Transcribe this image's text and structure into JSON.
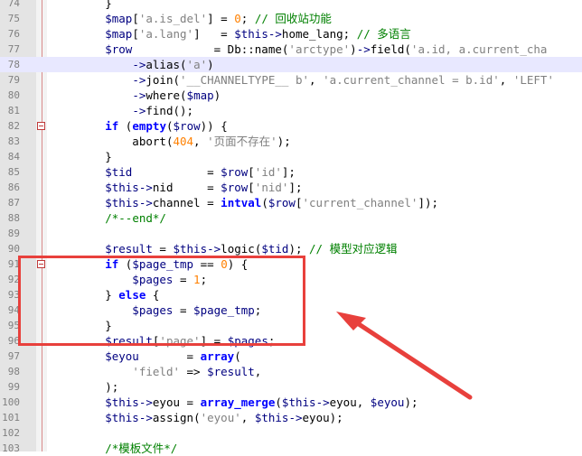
{
  "editor": {
    "lines": [
      {
        "n": "74",
        "fold": false,
        "current": false,
        "tokens": [
          {
            "t": "        }",
            "c": "plain"
          }
        ]
      },
      {
        "n": "75",
        "fold": false,
        "current": false,
        "tokens": [
          {
            "t": "        $map",
            "c": "var"
          },
          {
            "t": "[",
            "c": "plain"
          },
          {
            "t": "'a.is_del'",
            "c": "str"
          },
          {
            "t": "] = ",
            "c": "plain"
          },
          {
            "t": "0",
            "c": "num"
          },
          {
            "t": "; ",
            "c": "plain"
          },
          {
            "t": "// 回收站功能",
            "c": "com"
          }
        ]
      },
      {
        "n": "76",
        "fold": false,
        "current": false,
        "tokens": [
          {
            "t": "        $map",
            "c": "var"
          },
          {
            "t": "[",
            "c": "plain"
          },
          {
            "t": "'a.lang'",
            "c": "str"
          },
          {
            "t": "]   = ",
            "c": "plain"
          },
          {
            "t": "$this",
            "c": "var"
          },
          {
            "t": "->",
            "c": "op"
          },
          {
            "t": "home_lang",
            "c": "fn"
          },
          {
            "t": "; ",
            "c": "plain"
          },
          {
            "t": "// 多语言",
            "c": "com"
          }
        ]
      },
      {
        "n": "77",
        "fold": false,
        "current": false,
        "tokens": [
          {
            "t": "        $row",
            "c": "var"
          },
          {
            "t": "            = ",
            "c": "plain"
          },
          {
            "t": "Db::name",
            "c": "fn"
          },
          {
            "t": "(",
            "c": "plain"
          },
          {
            "t": "'arctype'",
            "c": "str"
          },
          {
            "t": ")",
            "c": "plain"
          },
          {
            "t": "->",
            "c": "op"
          },
          {
            "t": "field",
            "c": "fn"
          },
          {
            "t": "(",
            "c": "plain"
          },
          {
            "t": "'a.id, a.current_cha",
            "c": "str"
          }
        ]
      },
      {
        "n": "78",
        "fold": false,
        "current": true,
        "tokens": [
          {
            "t": "            ",
            "c": "plain"
          },
          {
            "t": "->",
            "c": "op"
          },
          {
            "t": "alias",
            "c": "fn"
          },
          {
            "t": "(",
            "c": "plain"
          },
          {
            "t": "'a'",
            "c": "str"
          },
          {
            "t": ")",
            "c": "plain"
          }
        ]
      },
      {
        "n": "79",
        "fold": false,
        "current": false,
        "tokens": [
          {
            "t": "            ",
            "c": "plain"
          },
          {
            "t": "->",
            "c": "op"
          },
          {
            "t": "join",
            "c": "fn"
          },
          {
            "t": "(",
            "c": "plain"
          },
          {
            "t": "'__CHANNELTYPE__ b'",
            "c": "str"
          },
          {
            "t": ", ",
            "c": "plain"
          },
          {
            "t": "'a.current_channel = b.id'",
            "c": "str"
          },
          {
            "t": ", ",
            "c": "plain"
          },
          {
            "t": "'LEFT'",
            "c": "str"
          }
        ]
      },
      {
        "n": "80",
        "fold": false,
        "current": false,
        "tokens": [
          {
            "t": "            ",
            "c": "plain"
          },
          {
            "t": "->",
            "c": "op"
          },
          {
            "t": "where",
            "c": "fn"
          },
          {
            "t": "(",
            "c": "plain"
          },
          {
            "t": "$map",
            "c": "var"
          },
          {
            "t": ")",
            "c": "plain"
          }
        ]
      },
      {
        "n": "81",
        "fold": false,
        "current": false,
        "tokens": [
          {
            "t": "            ",
            "c": "plain"
          },
          {
            "t": "->",
            "c": "op"
          },
          {
            "t": "find",
            "c": "fn"
          },
          {
            "t": "();",
            "c": "plain"
          }
        ]
      },
      {
        "n": "82",
        "fold": true,
        "current": false,
        "tokens": [
          {
            "t": "        ",
            "c": "plain"
          },
          {
            "t": "if",
            "c": "kw"
          },
          {
            "t": " (",
            "c": "plain"
          },
          {
            "t": "empty",
            "c": "kw"
          },
          {
            "t": "(",
            "c": "plain"
          },
          {
            "t": "$row",
            "c": "var"
          },
          {
            "t": ")) {",
            "c": "plain"
          }
        ]
      },
      {
        "n": "83",
        "fold": false,
        "current": false,
        "tokens": [
          {
            "t": "            abort",
            "c": "fn"
          },
          {
            "t": "(",
            "c": "plain"
          },
          {
            "t": "404",
            "c": "num"
          },
          {
            "t": ", ",
            "c": "plain"
          },
          {
            "t": "'页面不存在'",
            "c": "str"
          },
          {
            "t": ");",
            "c": "plain"
          }
        ]
      },
      {
        "n": "84",
        "fold": false,
        "current": false,
        "tokens": [
          {
            "t": "        }",
            "c": "plain"
          }
        ]
      },
      {
        "n": "85",
        "fold": false,
        "current": false,
        "tokens": [
          {
            "t": "        $tid",
            "c": "var"
          },
          {
            "t": "           = ",
            "c": "plain"
          },
          {
            "t": "$row",
            "c": "var"
          },
          {
            "t": "[",
            "c": "plain"
          },
          {
            "t": "'id'",
            "c": "str"
          },
          {
            "t": "];",
            "c": "plain"
          }
        ]
      },
      {
        "n": "86",
        "fold": false,
        "current": false,
        "tokens": [
          {
            "t": "        $this",
            "c": "var"
          },
          {
            "t": "->",
            "c": "op"
          },
          {
            "t": "nid",
            "c": "fn"
          },
          {
            "t": "     = ",
            "c": "plain"
          },
          {
            "t": "$row",
            "c": "var"
          },
          {
            "t": "[",
            "c": "plain"
          },
          {
            "t": "'nid'",
            "c": "str"
          },
          {
            "t": "];",
            "c": "plain"
          }
        ]
      },
      {
        "n": "87",
        "fold": false,
        "current": false,
        "tokens": [
          {
            "t": "        $this",
            "c": "var"
          },
          {
            "t": "->",
            "c": "op"
          },
          {
            "t": "channel",
            "c": "fn"
          },
          {
            "t": " = ",
            "c": "plain"
          },
          {
            "t": "intval",
            "c": "kw"
          },
          {
            "t": "(",
            "c": "plain"
          },
          {
            "t": "$row",
            "c": "var"
          },
          {
            "t": "[",
            "c": "plain"
          },
          {
            "t": "'current_channel'",
            "c": "str"
          },
          {
            "t": "]);",
            "c": "plain"
          }
        ]
      },
      {
        "n": "88",
        "fold": false,
        "current": false,
        "tokens": [
          {
            "t": "        ",
            "c": "plain"
          },
          {
            "t": "/*--end*/",
            "c": "com"
          }
        ]
      },
      {
        "n": "89",
        "fold": false,
        "current": false,
        "tokens": [
          {
            "t": "",
            "c": "plain"
          }
        ]
      },
      {
        "n": "90",
        "fold": false,
        "current": false,
        "tokens": [
          {
            "t": "        $result",
            "c": "var"
          },
          {
            "t": " = ",
            "c": "plain"
          },
          {
            "t": "$this",
            "c": "var"
          },
          {
            "t": "->",
            "c": "op"
          },
          {
            "t": "logic",
            "c": "fn"
          },
          {
            "t": "(",
            "c": "plain"
          },
          {
            "t": "$tid",
            "c": "var"
          },
          {
            "t": "); ",
            "c": "plain"
          },
          {
            "t": "// 模型对应逻辑",
            "c": "com"
          }
        ]
      },
      {
        "n": "91",
        "fold": true,
        "current": false,
        "tokens": [
          {
            "t": "        ",
            "c": "plain"
          },
          {
            "t": "if",
            "c": "kw"
          },
          {
            "t": " (",
            "c": "plain"
          },
          {
            "t": "$page_tmp",
            "c": "var"
          },
          {
            "t": " == ",
            "c": "plain"
          },
          {
            "t": "0",
            "c": "num"
          },
          {
            "t": ") {",
            "c": "plain"
          }
        ]
      },
      {
        "n": "92",
        "fold": false,
        "current": false,
        "tokens": [
          {
            "t": "            $pages",
            "c": "var"
          },
          {
            "t": " = ",
            "c": "plain"
          },
          {
            "t": "1",
            "c": "num"
          },
          {
            "t": ";",
            "c": "plain"
          }
        ]
      },
      {
        "n": "93",
        "fold": false,
        "current": false,
        "tokens": [
          {
            "t": "        } ",
            "c": "plain"
          },
          {
            "t": "else",
            "c": "kw"
          },
          {
            "t": " {",
            "c": "plain"
          }
        ]
      },
      {
        "n": "94",
        "fold": false,
        "current": false,
        "tokens": [
          {
            "t": "            $pages",
            "c": "var"
          },
          {
            "t": " = ",
            "c": "plain"
          },
          {
            "t": "$page_tmp",
            "c": "var"
          },
          {
            "t": ";",
            "c": "plain"
          }
        ]
      },
      {
        "n": "95",
        "fold": false,
        "current": false,
        "tokens": [
          {
            "t": "        }",
            "c": "plain"
          }
        ]
      },
      {
        "n": "96",
        "fold": false,
        "current": false,
        "tokens": [
          {
            "t": "        $result",
            "c": "var"
          },
          {
            "t": "[",
            "c": "plain"
          },
          {
            "t": "'page'",
            "c": "str"
          },
          {
            "t": "] = ",
            "c": "plain"
          },
          {
            "t": "$pages",
            "c": "var"
          },
          {
            "t": ";",
            "c": "plain"
          }
        ]
      },
      {
        "n": "97",
        "fold": false,
        "current": false,
        "tokens": [
          {
            "t": "        $eyou",
            "c": "var"
          },
          {
            "t": "       = ",
            "c": "plain"
          },
          {
            "t": "array",
            "c": "kw"
          },
          {
            "t": "(",
            "c": "plain"
          }
        ]
      },
      {
        "n": "98",
        "fold": false,
        "current": false,
        "tokens": [
          {
            "t": "            ",
            "c": "plain"
          },
          {
            "t": "'field'",
            "c": "str"
          },
          {
            "t": " => ",
            "c": "plain"
          },
          {
            "t": "$result",
            "c": "var"
          },
          {
            "t": ",",
            "c": "plain"
          }
        ]
      },
      {
        "n": "99",
        "fold": false,
        "current": false,
        "tokens": [
          {
            "t": "        );",
            "c": "plain"
          }
        ]
      },
      {
        "n": "100",
        "fold": false,
        "current": false,
        "tokens": [
          {
            "t": "        $this",
            "c": "var"
          },
          {
            "t": "->",
            "c": "op"
          },
          {
            "t": "eyou",
            "c": "fn"
          },
          {
            "t": " = ",
            "c": "plain"
          },
          {
            "t": "array_merge",
            "c": "kw"
          },
          {
            "t": "(",
            "c": "plain"
          },
          {
            "t": "$this",
            "c": "var"
          },
          {
            "t": "->",
            "c": "op"
          },
          {
            "t": "eyou",
            "c": "fn"
          },
          {
            "t": ", ",
            "c": "plain"
          },
          {
            "t": "$eyou",
            "c": "var"
          },
          {
            "t": ");",
            "c": "plain"
          }
        ]
      },
      {
        "n": "101",
        "fold": false,
        "current": false,
        "tokens": [
          {
            "t": "        $this",
            "c": "var"
          },
          {
            "t": "->",
            "c": "op"
          },
          {
            "t": "assign",
            "c": "fn"
          },
          {
            "t": "(",
            "c": "plain"
          },
          {
            "t": "'eyou'",
            "c": "str"
          },
          {
            "t": ", ",
            "c": "plain"
          },
          {
            "t": "$this",
            "c": "var"
          },
          {
            "t": "->",
            "c": "op"
          },
          {
            "t": "eyou",
            "c": "fn"
          },
          {
            "t": ");",
            "c": "plain"
          }
        ]
      },
      {
        "n": "102",
        "fold": false,
        "current": false,
        "tokens": [
          {
            "t": "",
            "c": "plain"
          }
        ]
      },
      {
        "n": "103",
        "fold": false,
        "current": false,
        "tokens": [
          {
            "t": "        ",
            "c": "plain"
          },
          {
            "t": "/*模板文件*/",
            "c": "com"
          }
        ]
      }
    ]
  },
  "annotation": {
    "box_color": "#e8403c",
    "arrow_color": "#e8403c"
  }
}
